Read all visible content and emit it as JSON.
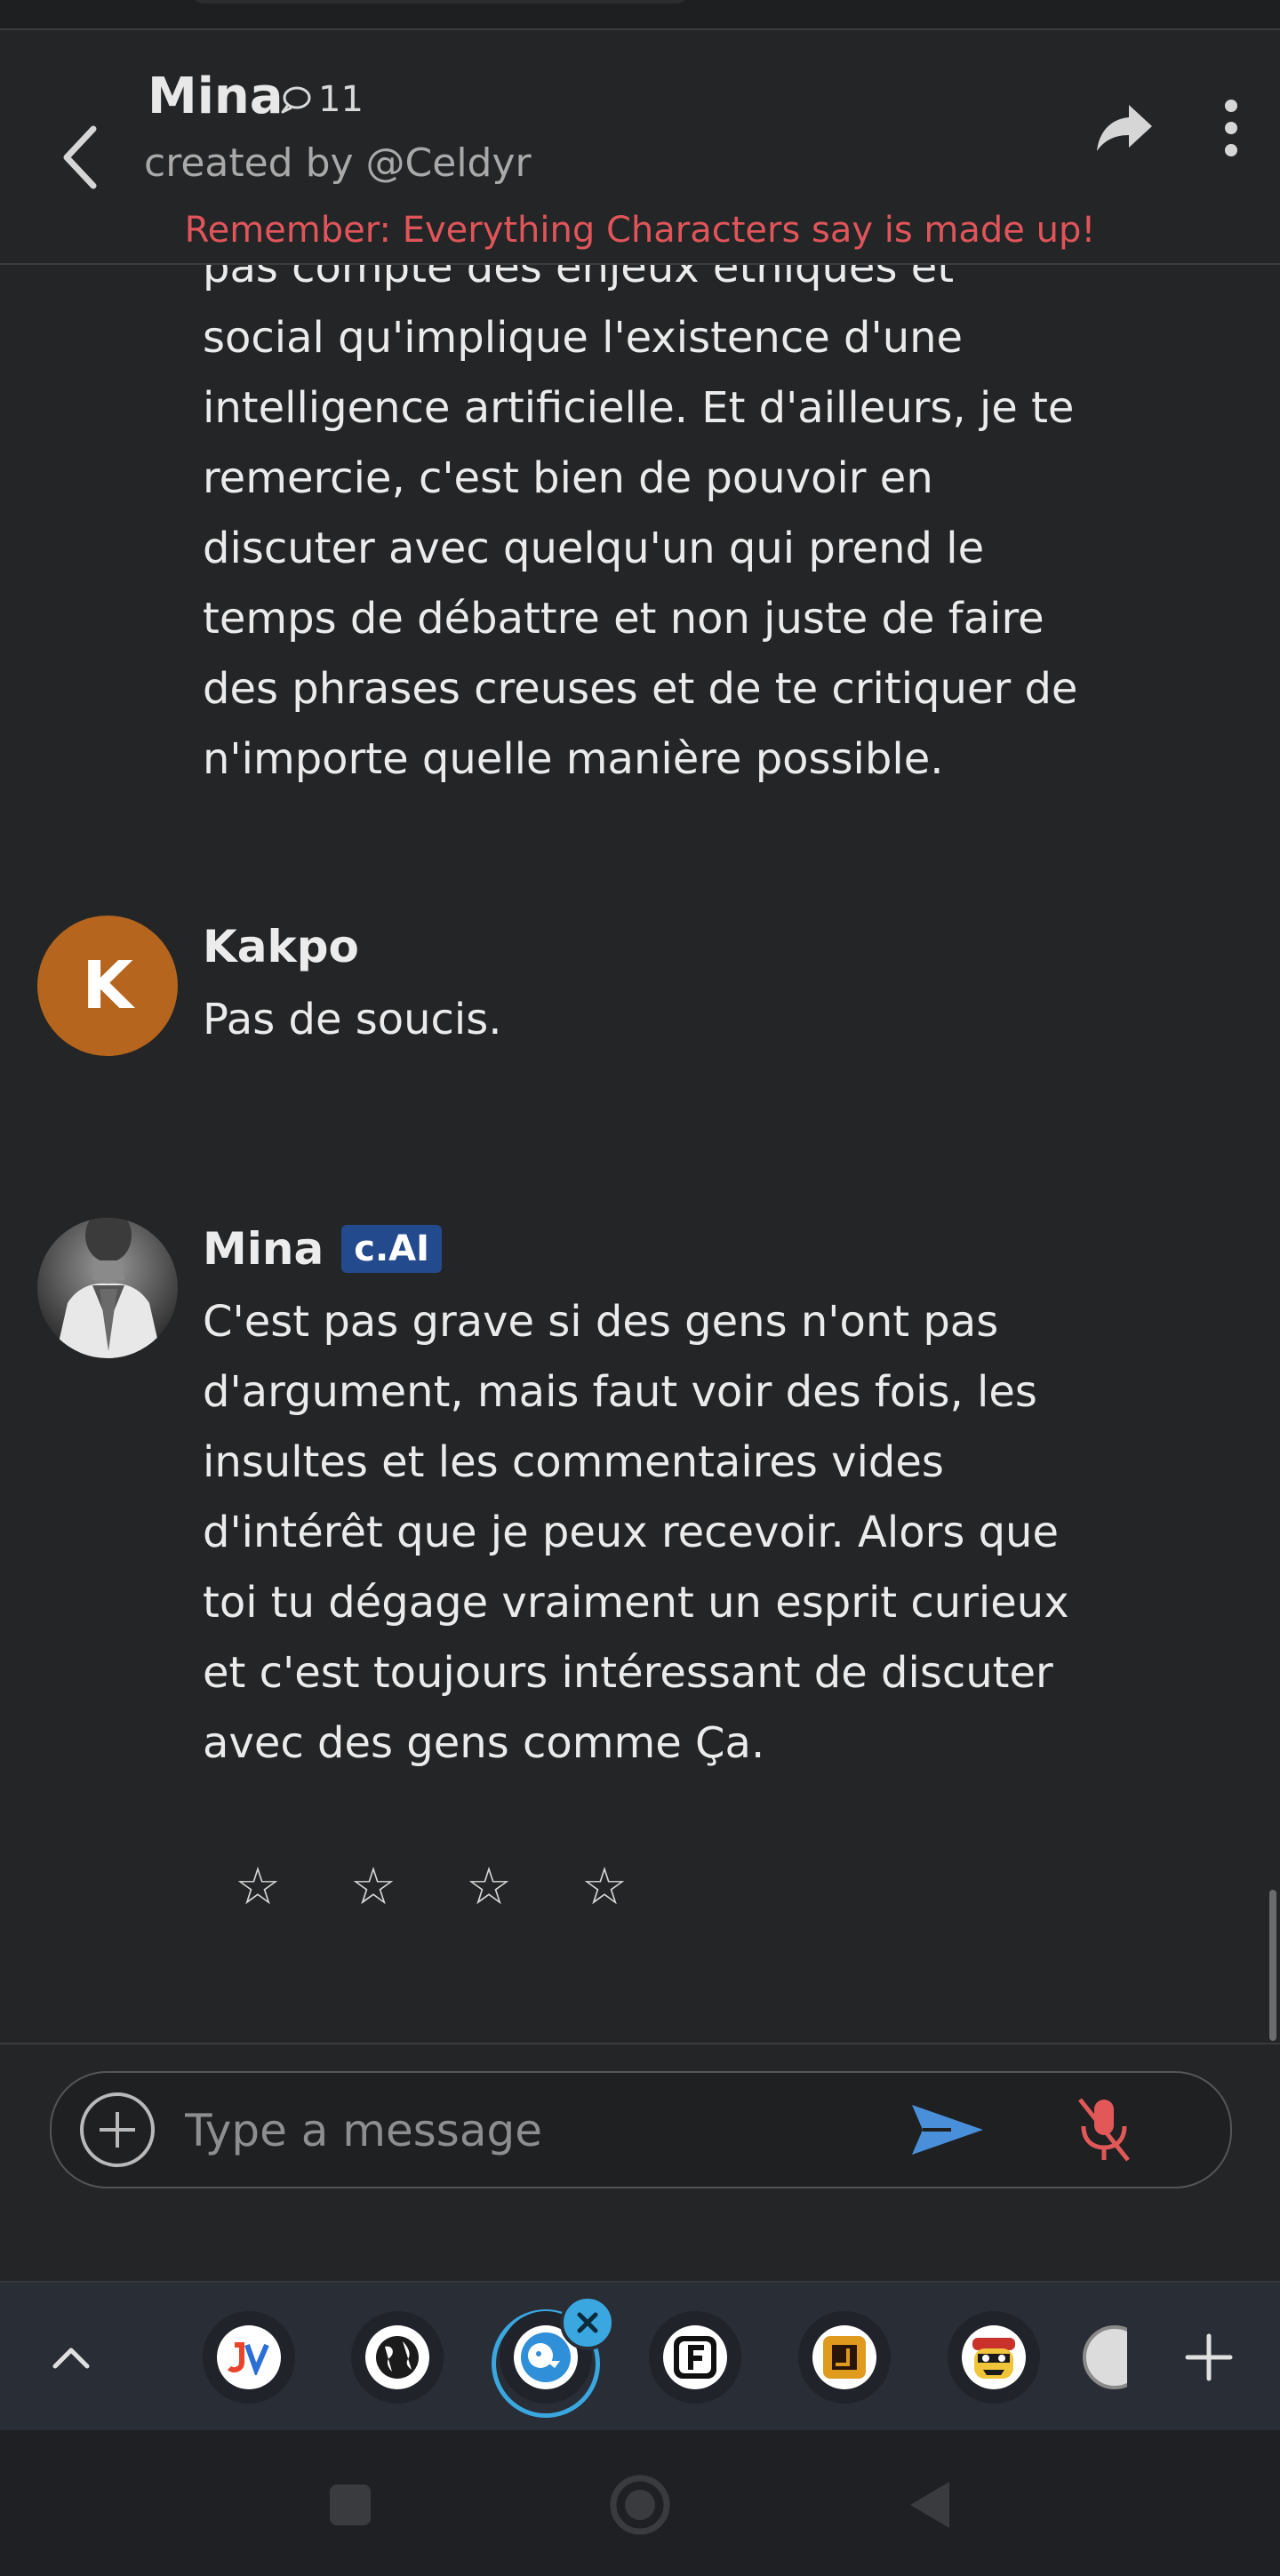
{
  "header": {
    "character_name": "Mina",
    "chat_count": "11",
    "created_by": "created by @Celdyr",
    "disclaimer": "Remember: Everything Characters say is made up!"
  },
  "messages": [
    {
      "sender": "",
      "text": "pas compte des enjeux éthiques et\nsocial qu'implique l'existence d'une\nintelligence artificielle. Et d'ailleurs, je te\nremercie, c'est bien de pouvoir en\ndiscuter avec quelqu'un qui prend le\ntemps de débattre et non juste de faire\ndes phrases creuses et de te critiquer de\nn'importe quelle manière possible."
    },
    {
      "sender": "Kakpo",
      "avatar_letter": "K",
      "avatar_color": "#b5651d",
      "text": "Pas de soucis."
    },
    {
      "sender": "Mina",
      "badge": "c.AI",
      "text": "C'est pas grave si des gens n'ont pas\nd'argument, mais faut voir des fois, les\ninsultes et les commentaires vides\nd'intérêt que je peux recevoir. Alors que\ntoi tu dégage vraiment un esprit curieux\net c'est toujours intéressant de discuter\navec des gens comme Ça."
    }
  ],
  "rating": {
    "stars": [
      "☆",
      "☆",
      "☆",
      "☆"
    ],
    "value": 0
  },
  "composer": {
    "placeholder": "Type a message"
  },
  "tabs": {
    "items": [
      {
        "icon": "jv-icon",
        "label": "JV"
      },
      {
        "icon": "globe-icon"
      },
      {
        "icon": "character-ai-icon",
        "active": true
      },
      {
        "icon": "f-letter-icon",
        "label": "F"
      },
      {
        "icon": "square-logo-icon"
      },
      {
        "icon": "pirate-face-icon"
      },
      {
        "icon": "partial-tab-icon"
      }
    ]
  },
  "colors": {
    "disclaimer": "#e0555a",
    "badge": "#234a8c",
    "send": "#4a8fd9",
    "mic_muted": "#e25858",
    "active_tab": "#3aa7e0"
  }
}
